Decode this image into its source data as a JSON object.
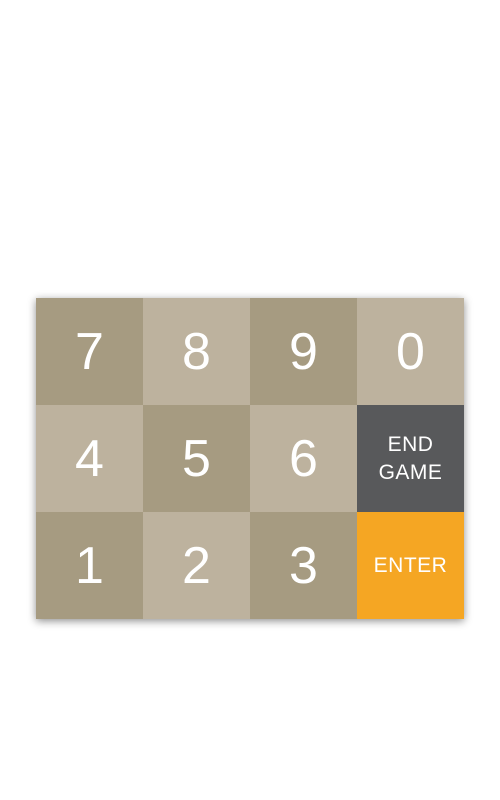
{
  "keypad": {
    "keys": [
      {
        "label": "7",
        "shade": "dark"
      },
      {
        "label": "8",
        "shade": "light"
      },
      {
        "label": "9",
        "shade": "dark"
      },
      {
        "label": "0",
        "shade": "light"
      },
      {
        "label": "4",
        "shade": "light"
      },
      {
        "label": "5",
        "shade": "dark"
      },
      {
        "label": "6",
        "shade": "light"
      },
      {
        "label": "1",
        "shade": "dark"
      },
      {
        "label": "2",
        "shade": "light"
      },
      {
        "label": "3",
        "shade": "dark"
      }
    ],
    "end_game": {
      "line1": "END",
      "line2": "GAME"
    },
    "enter": {
      "label": "ENTER"
    },
    "colors": {
      "dark_tile": "#a69b81",
      "light_tile": "#bdb29e",
      "end_game": "#58595b",
      "enter": "#f5a623",
      "text": "#ffffff"
    }
  }
}
